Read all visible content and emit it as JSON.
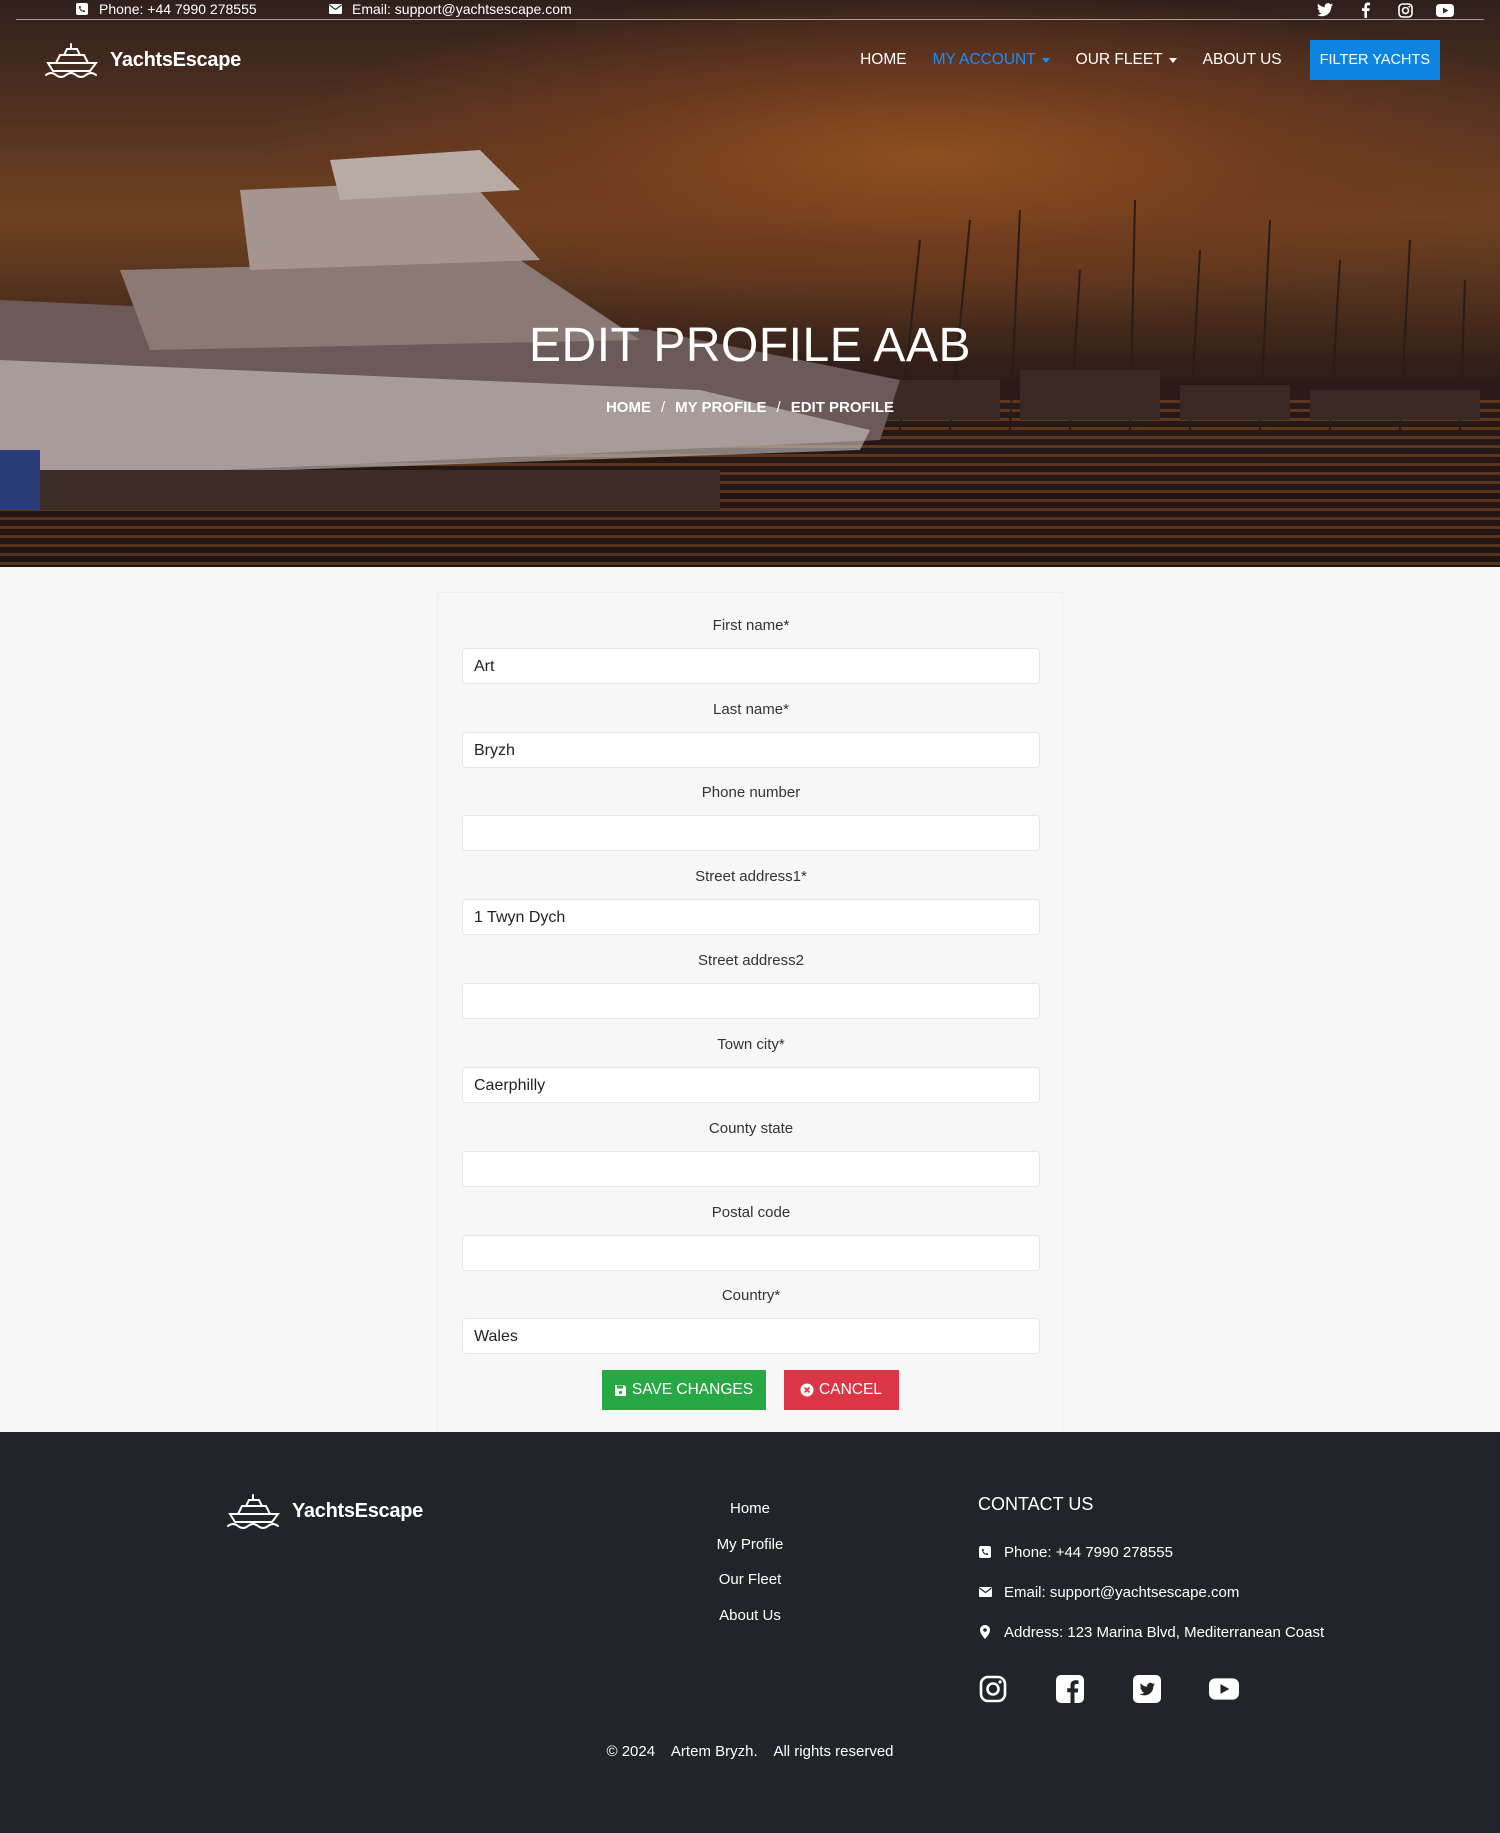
{
  "topbar": {
    "phone": "Phone: +44 7990 278555",
    "email": "Email: support@yachtsescape.com",
    "social_icons": [
      "twitter-icon",
      "facebook-icon",
      "instagram-icon",
      "youtube-icon"
    ]
  },
  "brand": {
    "name": "YachtsEscape"
  },
  "nav": {
    "home": "HOME",
    "my_account": "MY ACCOUNT",
    "our_fleet": "OUR FLEET",
    "about_us": "ABOUT US",
    "filter_yachts": "FILTER YACHTS"
  },
  "hero": {
    "title": "EDIT PROFILE AAB",
    "breadcrumb": {
      "home": "HOME",
      "sep": "/",
      "my_profile": "MY PROFILE",
      "current": "EDIT PROFILE"
    }
  },
  "form": {
    "fields": [
      {
        "label": "First name*",
        "value": "Art"
      },
      {
        "label": "Last name*",
        "value": "Bryzh"
      },
      {
        "label": "Phone number",
        "value": ""
      },
      {
        "label": "Street address1*",
        "value": "1 Twyn Dych"
      },
      {
        "label": "Street address2",
        "value": ""
      },
      {
        "label": "Town city*",
        "value": "Caerphilly"
      },
      {
        "label": "County state",
        "value": ""
      },
      {
        "label": "Postal code",
        "value": ""
      },
      {
        "label": "Country*",
        "value": "Wales"
      }
    ],
    "save_label": "SAVE CHANGES",
    "cancel_label": "CANCEL"
  },
  "footer": {
    "links": [
      "Home",
      "My Profile",
      "Our Fleet",
      "About Us"
    ],
    "contact_title": "CONTACT US",
    "phone": "Phone: +44 7990 278555",
    "email": "Email: support@yachtsescape.com",
    "address": "Address: 123 Marina Blvd, Mediterranean Coast",
    "social_icons": [
      "instagram-icon",
      "facebook-square-icon",
      "twitter-square-icon",
      "youtube-icon"
    ],
    "copyright": "© 2024    Artem Bryzh.    All rights reserved"
  },
  "colors": {
    "accent": "#0d84e0",
    "active_nav": "#1a8cff",
    "save": "#28a745",
    "cancel": "#dc3545",
    "footer_bg": "#212529"
  }
}
